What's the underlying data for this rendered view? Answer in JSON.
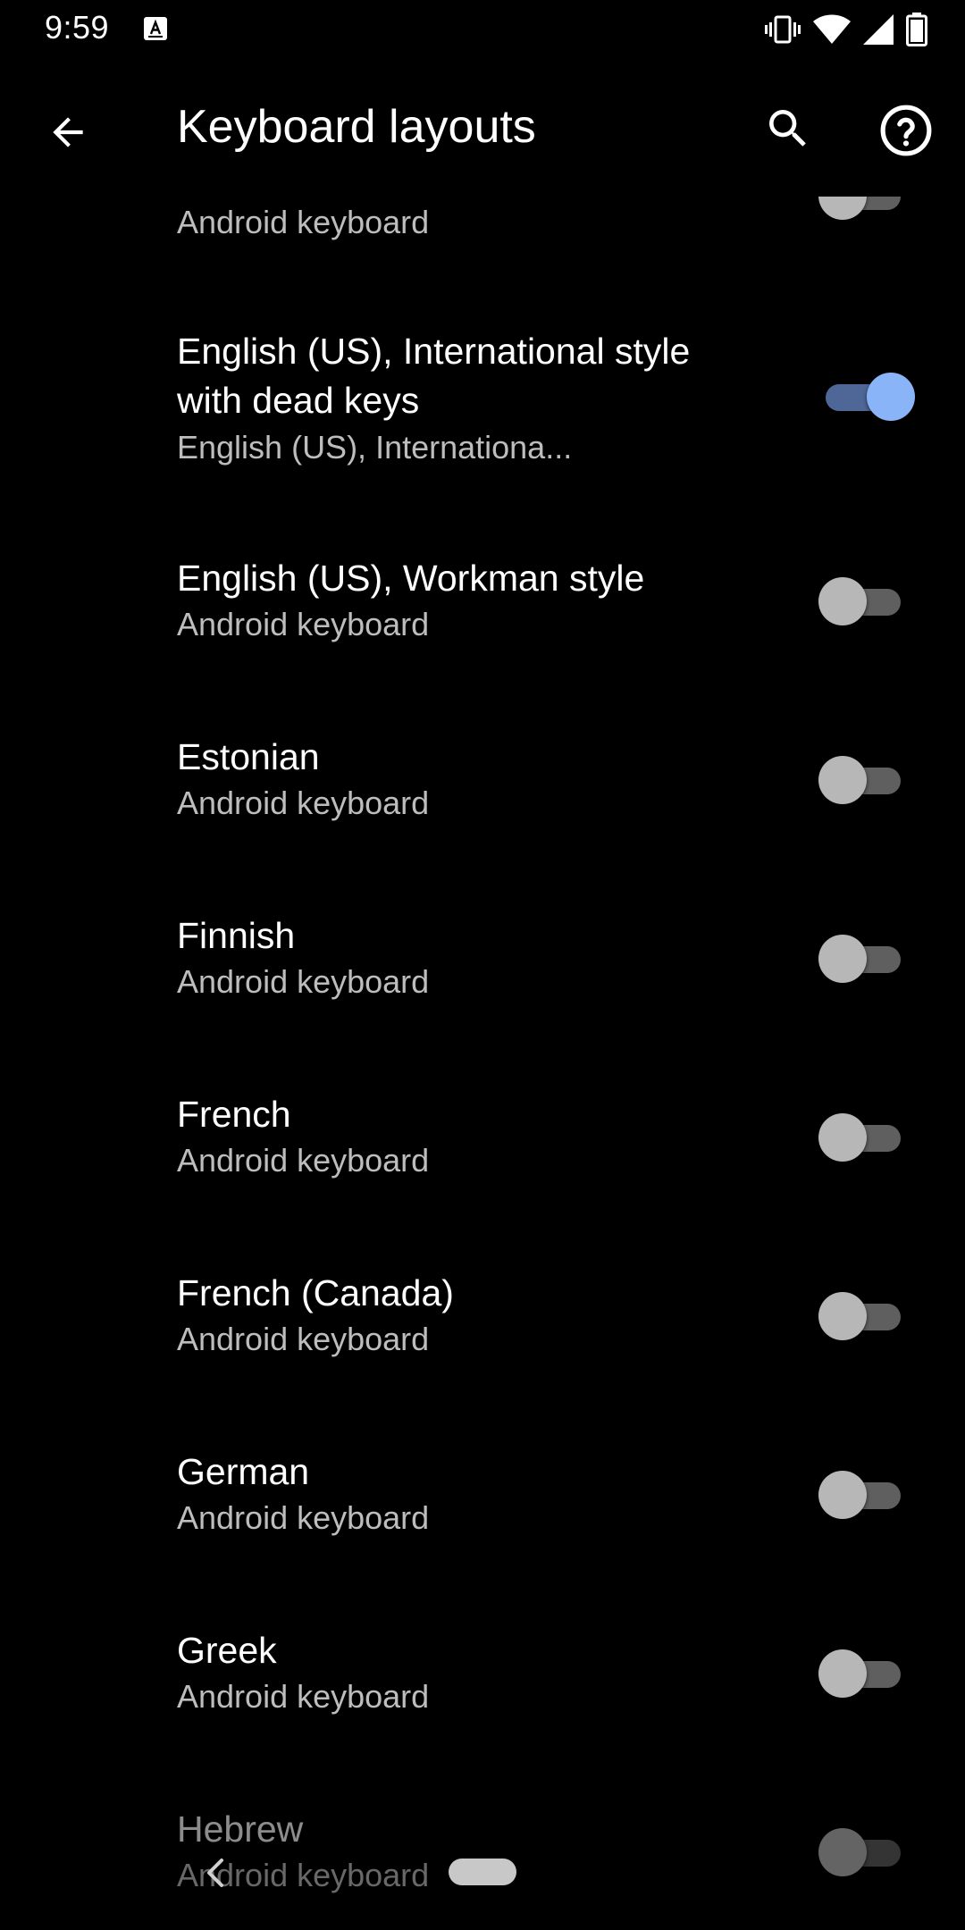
{
  "status_bar": {
    "time": "9:59",
    "icons": [
      "keyboard-app-icon",
      "vibrate-icon",
      "wifi-icon",
      "signal-icon",
      "battery-icon"
    ]
  },
  "app_bar": {
    "title": "Keyboard layouts",
    "back_icon": "arrow-back-icon",
    "search_icon": "search-icon",
    "help_icon": "help-icon"
  },
  "colors": {
    "background": "#000000",
    "accent": "#8ab4f8",
    "accent_track": "#4f6796",
    "subtitle": "#bdbdbd"
  },
  "layouts": [
    {
      "title": "",
      "subtitle": "Android keyboard",
      "enabled": false
    },
    {
      "title": "English (US), International style with dead keys",
      "subtitle": "English (US), Internationa...",
      "enabled": true
    },
    {
      "title": "English (US), Workman style",
      "subtitle": "Android keyboard",
      "enabled": false
    },
    {
      "title": "Estonian",
      "subtitle": "Android keyboard",
      "enabled": false
    },
    {
      "title": "Finnish",
      "subtitle": "Android keyboard",
      "enabled": false
    },
    {
      "title": "French",
      "subtitle": "Android keyboard",
      "enabled": false
    },
    {
      "title": "French (Canada)",
      "subtitle": "Android keyboard",
      "enabled": false
    },
    {
      "title": "German",
      "subtitle": "Android keyboard",
      "enabled": false
    },
    {
      "title": "Greek",
      "subtitle": "Android keyboard",
      "enabled": false
    },
    {
      "title": "Hebrew",
      "subtitle": "Android keyboard",
      "enabled": false
    }
  ],
  "nav_bar": {
    "back_icon": "nav-back-icon",
    "home_icon": "home-pill-icon"
  }
}
